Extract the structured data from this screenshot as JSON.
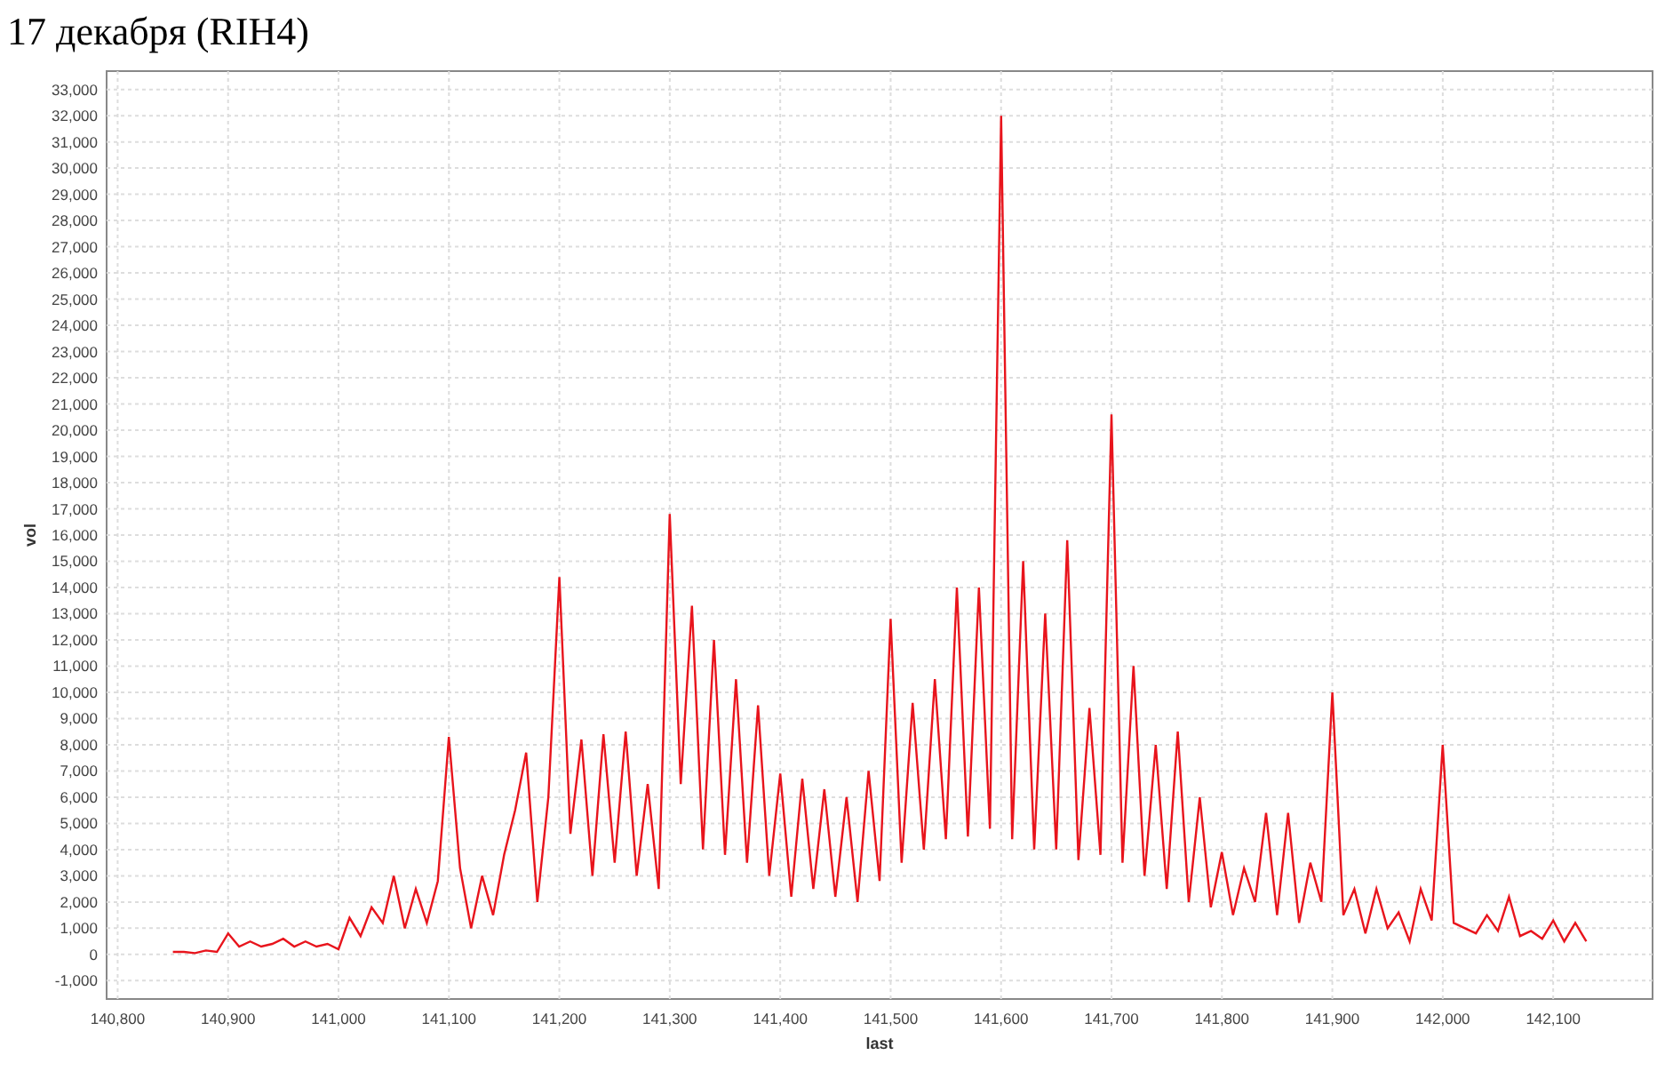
{
  "title": "17 декабря (RIH4)",
  "chart": {
    "chart_data": {
      "type": "line",
      "xlabel": "last",
      "ylabel": "vol",
      "x": [
        140850,
        140860,
        140870,
        140880,
        140890,
        140900,
        140910,
        140920,
        140930,
        140940,
        140950,
        140960,
        140970,
        140980,
        140990,
        141000,
        141010,
        141020,
        141030,
        141040,
        141050,
        141060,
        141070,
        141080,
        141090,
        141100,
        141110,
        141120,
        141130,
        141140,
        141150,
        141160,
        141170,
        141180,
        141190,
        141200,
        141210,
        141220,
        141230,
        141240,
        141250,
        141260,
        141270,
        141280,
        141290,
        141300,
        141310,
        141320,
        141330,
        141340,
        141350,
        141360,
        141370,
        141380,
        141390,
        141400,
        141410,
        141420,
        141430,
        141440,
        141450,
        141460,
        141470,
        141480,
        141490,
        141500,
        141510,
        141520,
        141530,
        141540,
        141550,
        141560,
        141570,
        141580,
        141590,
        141600,
        141610,
        141620,
        141630,
        141640,
        141650,
        141660,
        141670,
        141680,
        141690,
        141700,
        141710,
        141720,
        141730,
        141740,
        141750,
        141760,
        141770,
        141780,
        141790,
        141800,
        141810,
        141820,
        141830,
        141840,
        141850,
        141860,
        141870,
        141880,
        141890,
        141900,
        141910,
        141920,
        141930,
        141940,
        141950,
        141960,
        141970,
        141980,
        141990,
        142000,
        142010,
        142020,
        142030,
        142040,
        142050,
        142060,
        142070,
        142080,
        142090,
        142100,
        142110,
        142120,
        142130
      ],
      "grid": true,
      "series": [
        {
          "color": "#e8141c",
          "values": [
            100,
            100,
            50,
            150,
            100,
            800,
            300,
            500,
            300,
            400,
            600,
            300,
            500,
            300,
            400,
            200,
            1400,
            700,
            1800,
            1200,
            3000,
            1000,
            2500,
            1200,
            2800,
            8300,
            3300,
            1000,
            3000,
            1500,
            3800,
            5500,
            7700,
            2000,
            6000,
            14400,
            4600,
            8200,
            3000,
            8400,
            3500,
            8500,
            3000,
            6500,
            2500,
            16800,
            6500,
            13300,
            4000,
            12000,
            3800,
            10500,
            3500,
            9500,
            3000,
            6900,
            2200,
            6700,
            2500,
            6300,
            2200,
            6000,
            2000,
            7000,
            2800,
            12800,
            3500,
            9600,
            4000,
            10500,
            4400,
            14000,
            4500,
            14000,
            4800,
            32000,
            4400,
            15000,
            4000,
            13000,
            4000,
            15800,
            3600,
            9400,
            3800,
            20600,
            3500,
            11000,
            3000,
            8000,
            2500,
            8500,
            2000,
            6000,
            1800,
            3900,
            1500,
            3300,
            2000,
            5400,
            1500,
            5400,
            1200,
            3500,
            2000,
            10000,
            1500,
            2500,
            800,
            2500,
            1000,
            1600,
            500,
            2500,
            1300,
            8000,
            1200,
            1000,
            800,
            1500,
            900,
            2200,
            700,
            900,
            600,
            1300,
            500,
            1200,
            500
          ]
        }
      ],
      "xlim": [
        140790,
        142190
      ],
      "ylim": [
        -1700,
        33700
      ],
      "xticks": [
        {
          "value": 140800,
          "label": "140,800"
        },
        {
          "value": 140900,
          "label": "140,900"
        },
        {
          "value": 141000,
          "label": "141,000"
        },
        {
          "value": 141100,
          "label": "141,100"
        },
        {
          "value": 141200,
          "label": "141,200"
        },
        {
          "value": 141300,
          "label": "141,300"
        },
        {
          "value": 141400,
          "label": "141,400"
        },
        {
          "value": 141500,
          "label": "141,500"
        },
        {
          "value": 141600,
          "label": "141,600"
        },
        {
          "value": 141700,
          "label": "141,700"
        },
        {
          "value": 141800,
          "label": "141,800"
        },
        {
          "value": 141900,
          "label": "141,900"
        },
        {
          "value": 142000,
          "label": "142,000"
        },
        {
          "value": 142100,
          "label": "142,100"
        }
      ],
      "yticks": [
        {
          "value": -1000,
          "label": "-1,000"
        },
        {
          "value": 0,
          "label": "0"
        },
        {
          "value": 1000,
          "label": "1,000"
        },
        {
          "value": 2000,
          "label": "2,000"
        },
        {
          "value": 3000,
          "label": "3,000"
        },
        {
          "value": 4000,
          "label": "4,000"
        },
        {
          "value": 5000,
          "label": "5,000"
        },
        {
          "value": 6000,
          "label": "6,000"
        },
        {
          "value": 7000,
          "label": "7,000"
        },
        {
          "value": 8000,
          "label": "8,000"
        },
        {
          "value": 9000,
          "label": "9,000"
        },
        {
          "value": 10000,
          "label": "10,000"
        },
        {
          "value": 11000,
          "label": "11,000"
        },
        {
          "value": 12000,
          "label": "12,000"
        },
        {
          "value": 13000,
          "label": "13,000"
        },
        {
          "value": 14000,
          "label": "14,000"
        },
        {
          "value": 15000,
          "label": "15,000"
        },
        {
          "value": 16000,
          "label": "16,000"
        },
        {
          "value": 17000,
          "label": "17,000"
        },
        {
          "value": 18000,
          "label": "18,000"
        },
        {
          "value": 19000,
          "label": "19,000"
        },
        {
          "value": 20000,
          "label": "20,000"
        },
        {
          "value": 21000,
          "label": "21,000"
        },
        {
          "value": 22000,
          "label": "22,000"
        },
        {
          "value": 23000,
          "label": "23,000"
        },
        {
          "value": 24000,
          "label": "24,000"
        },
        {
          "value": 25000,
          "label": "25,000"
        },
        {
          "value": 26000,
          "label": "26,000"
        },
        {
          "value": 27000,
          "label": "27,000"
        },
        {
          "value": 28000,
          "label": "28,000"
        },
        {
          "value": 29000,
          "label": "29,000"
        },
        {
          "value": 30000,
          "label": "30,000"
        },
        {
          "value": 31000,
          "label": "31,000"
        },
        {
          "value": 32000,
          "label": "32,000"
        },
        {
          "value": 33000,
          "label": "33,000"
        }
      ]
    }
  }
}
